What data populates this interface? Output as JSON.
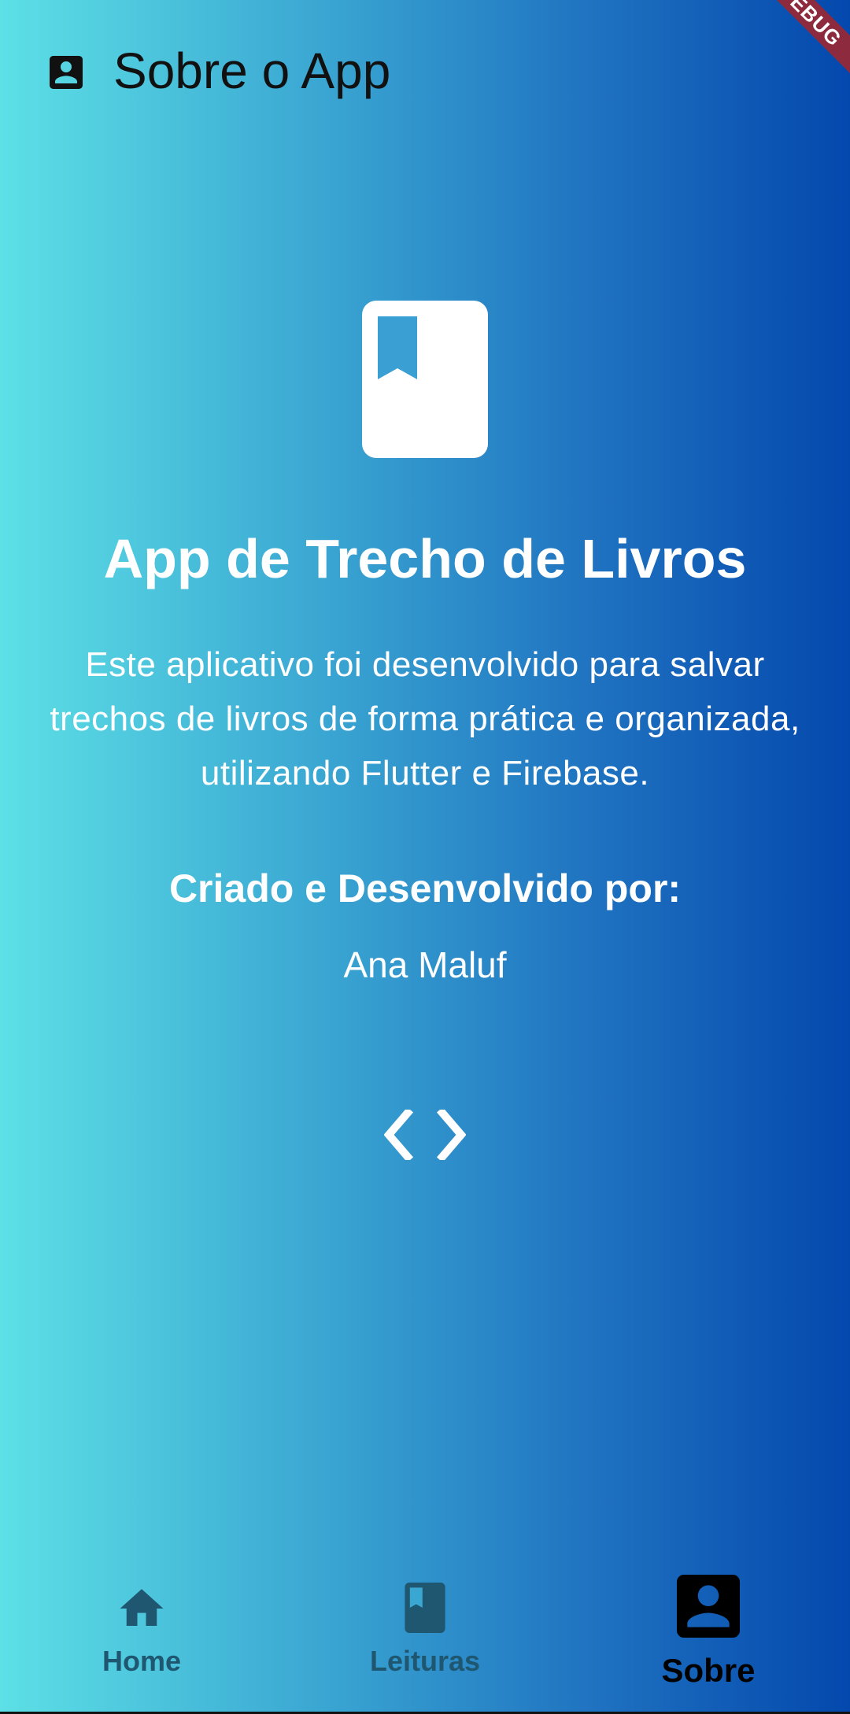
{
  "app_bar": {
    "title": "Sobre o App",
    "icon": "account-box-icon"
  },
  "debug_banner": {
    "label": "DEBUG"
  },
  "about": {
    "icon": "book-icon",
    "title": "App de Trecho de Livros",
    "description": "Este aplicativo foi desenvolvido para salvar trechos de livros de forma prática e organizada, utilizando Flutter e Firebase.",
    "credits_heading": "Criado e Desenvolvido por:",
    "author": "Ana Maluf",
    "code_icon": "code-icon"
  },
  "bottom_nav": {
    "items": [
      {
        "label": "Home",
        "icon": "home-icon",
        "active": false
      },
      {
        "label": "Leituras",
        "icon": "book-icon",
        "active": false
      },
      {
        "label": "Sobre",
        "icon": "account-box-icon",
        "active": true
      }
    ]
  },
  "colors": {
    "gradient_start": "#5de0e6",
    "gradient_end": "#0448ad",
    "inactive_nav": "#1f5670",
    "active_nav": "#000000",
    "debug_banner": "#8e2a3e"
  }
}
